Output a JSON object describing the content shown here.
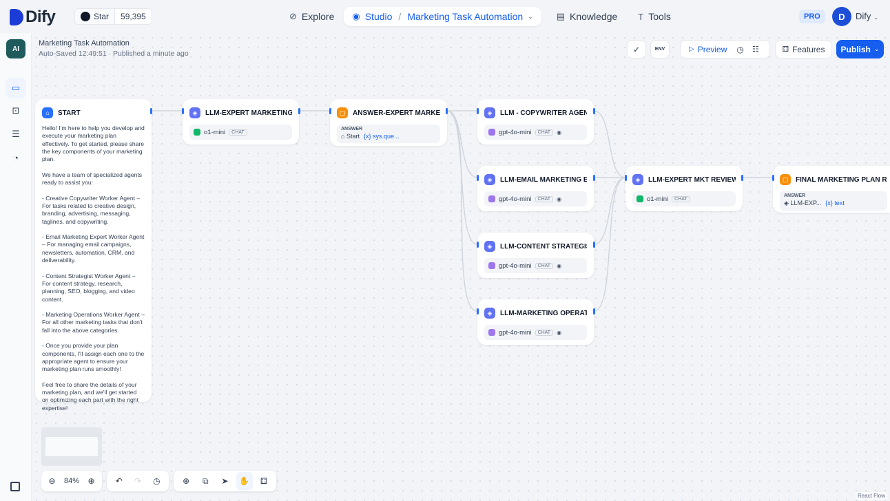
{
  "header": {
    "logo_text": "Dify",
    "github": {
      "star_label": "Star",
      "star_count": "59,395"
    },
    "nav": {
      "explore": "Explore",
      "studio": "Studio",
      "app_selector": "Marketing Task Automation",
      "knowledge": "Knowledge",
      "tools": "Tools"
    },
    "plan_badge": "PRO",
    "user_initial": "D",
    "user_name": "Dify"
  },
  "app": {
    "icon_label": "AI",
    "title": "Marketing Task Automation",
    "save_status": "Auto-Saved 12:49:51 · Published a minute ago"
  },
  "toolbar": {
    "env_label": "ENV",
    "preview_label": "Preview",
    "features_label": "Features",
    "publish_label": "Publish"
  },
  "nodes": {
    "start": {
      "title": "START",
      "text": "Hello! I'm here to help you develop and execute your marketing plan effectively. To get started, please share the key components of your marketing plan.\n\nWe have a team of specialized agents ready to assist you:\n\n- Creative Copywriter Worker Agent – For tasks related to creative design, branding, advertising, messaging, taglines, and copywriting.\n\n- Email Marketing Expert Worker Agent – For managing email campaigns, newsletters, automation, CRM, and deliverability.\n\n- Content Strategist Worker Agent – For content strategy, research, planning, SEO, blogging, and video content.\n\n- Marketing Operations Worker Agent – For all other marketing tasks that don't fall into the above categories.\n\n- Once you provide your plan components, I'll assign each one to the appropriate agent to ensure your marketing plan runs smoothly!\n\nFeel free to share the details of your marketing plan, and we'll get started on optimizing each part with the right expertise!"
    },
    "llm_expert": {
      "title": "LLM-EXPERT MARKETING",
      "model": "o1-mini",
      "mode": "CHAT"
    },
    "answer_expert": {
      "title": "ANSWER-EXPERT MARKETING",
      "answer_label": "ANSWER",
      "source": "Start",
      "variable": "{x} sys.que..."
    },
    "llm_copywriter": {
      "title": "LLM - COPYWRITER AGENT",
      "model": "gpt-4o-mini",
      "mode": "CHAT"
    },
    "llm_email": {
      "title": "LLM-EMAIL MARKETING EXPE",
      "model": "gpt-4o-mini",
      "mode": "CHAT"
    },
    "llm_content": {
      "title": "LLM-CONTENT STRATEGIST",
      "model": "gpt-4o-mini",
      "mode": "CHAT"
    },
    "llm_ops": {
      "title": "LLM-MARKETING OPERATION",
      "model": "gpt-4o-mini",
      "mode": "CHAT"
    },
    "llm_review": {
      "title": "LLM-EXPERT MKT REVIEW",
      "model": "o1-mini",
      "mode": "CHAT"
    },
    "final_answer": {
      "title": "FINAL MARKETING PLAN REVI",
      "answer_label": "ANSWER",
      "source": "LLM-EXP...",
      "variable": "{x} text"
    }
  },
  "controls": {
    "zoom": "84%"
  },
  "attribution": "React Flow"
}
